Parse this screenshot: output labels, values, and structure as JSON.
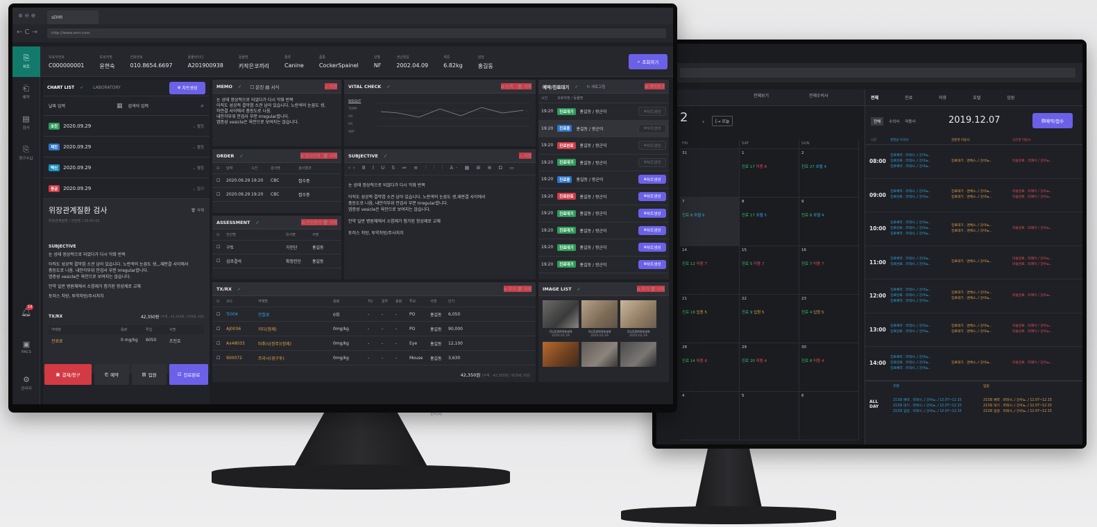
{
  "browser": {
    "tab": "sEMR",
    "url": "http://www.emr.com"
  },
  "patient": [
    {
      "label": "보호자번호",
      "value": "C000000001"
    },
    {
      "label": "보호자명",
      "value": "윤현숙"
    },
    {
      "label": "전화번호",
      "value": "010.8654.6697"
    },
    {
      "label": "동물바이디",
      "value": "A201900938"
    },
    {
      "label": "동물명",
      "value": "키작은코끼리"
    },
    {
      "label": "종류",
      "value": "Canine"
    },
    {
      "label": "품종",
      "value": "CockerSpainel"
    },
    {
      "label": "성별",
      "value": "NF"
    },
    {
      "label": "생년월일",
      "value": "2002.04.09"
    },
    {
      "label": "체중",
      "value": "6.82kg"
    },
    {
      "label": "담당",
      "value": "홍길동"
    }
  ],
  "search_button": "조회하기",
  "sidebar": [
    {
      "label": "차트"
    },
    {
      "label": "예약"
    },
    {
      "label": "검사"
    },
    {
      "label": "청구수납"
    },
    {
      "label": "PACS"
    },
    {
      "label": "관리자"
    }
  ],
  "notification_count": "14",
  "chart_list": {
    "tab1": "CHART LIST",
    "tab2": "LABORATORY",
    "new_button": "차트생성",
    "date_placeholder": "날짜 입력",
    "search_placeholder": "검색어 입력",
    "entries": [
      {
        "tag": "초진",
        "date": "2020.09.29",
        "color": "g",
        "action": "펼침"
      },
      {
        "tag": "재진",
        "date": "2020.09.29",
        "color": "b",
        "action": "펼침"
      },
      {
        "tag": "백신",
        "date": "2020.09.29",
        "color": "cy",
        "action": "펼침"
      },
      {
        "tag": "응급",
        "date": "2020.09.29",
        "color": "r",
        "action": "접기"
      }
    ],
    "detail_title": "위장관계질환 검사",
    "detail_sub": "위장관계질환 / 진단명 / 15:41:02",
    "delete": "삭제",
    "subjective_head": "SUBJECTIVE",
    "subjective_lines": [
      "눈 상태 정상적으로 되었다가 다시 악화 반복",
      "아직도 성공적 결막염 소견 남아 있습니다. 노란색의 눈꼽도 생,,,재판결 사이에서",
      "충등도로 나옴. 내안각부위 안검사 부분 Irregular합니다.",
      "엽증성 vesicle은 육안으로 보여지는 않습니다.",
      "안약 일반 병원체에서 소염제가 첨가된 항상제로 교체",
      "토러스 처방, 투약처방/주사처치"
    ],
    "txrx_label": "TX/RX",
    "txrx_total": "42,350원",
    "txrx_total_note": "(수액 , 42,350원 / 비과세, 0원)",
    "txrx_cols": [
      "약재명",
      "용량",
      "투입",
      "서명"
    ],
    "txrx_row": [
      "진료료",
      "0 mg/kg",
      "6050",
      "조진호"
    ],
    "buttons": {
      "pay": "결제/청구",
      "reserve": "예약",
      "admit": "입원",
      "done": "진료완료"
    }
  },
  "memo": {
    "title": "MEMO",
    "opt1": "문진",
    "opt2": "서식",
    "save": "저장",
    "lines": [
      "눈 상태 정상적으로 되었다가 다시 악화 반복",
      "아직도 성공적 결막염 소견 남아 있습니다. 노란색의 눈꼽도 생,",
      "하얀결 사이에서 충등도로 나옴.",
      "내안각부위 안검사 부분 Irregular합니다.",
      "엽증성 vesicle은 육안으로 보여지는 않습니다."
    ]
  },
  "vital": {
    "title": "VITAL CHECK",
    "add": "등록",
    "del": "삭제",
    "rows": [
      "WEIGHT",
      "TEMP",
      "HR",
      "RR",
      "SBP"
    ]
  },
  "order": {
    "title": "ORDER",
    "apply": "검사신청",
    "del": "삭제",
    "cols": [
      "날짜",
      "시간",
      "검사명",
      "검사결과"
    ],
    "rows": [
      [
        "2020.09.29",
        "19:20",
        "CBC",
        "접수중"
      ],
      [
        "2020.09.29",
        "19:20",
        "CBC",
        "접수중"
      ]
    ]
  },
  "assessment": {
    "title": "ASSESSMENT",
    "add": "진단추가",
    "del": "삭제",
    "cols": [
      "진단명",
      "유사명",
      "서명"
    ],
    "rows": [
      [
        "구토",
        "가진단",
        "홍길동"
      ],
      [
        "심로결석",
        "확정진단",
        "홍길동"
      ]
    ]
  },
  "subjective": {
    "title": "SUBJECTIVE",
    "save": "저장",
    "lines": [
      "눈 상태 정상적으로 되었다가 다시 악화 반복",
      "아직도 성공적 결막염 소견 남아 있습니다. 노란색의 눈꼽도 생,재판결 사이에서",
      "충등도로 나옴, 내안각부위 안검사 부분 Irregular합니다.",
      "엽증성 vesicle은 육안으로 보여지는 않습니다.",
      "안약 일반 병원체에서 소염제가 첨가된 항상제로 교체",
      "토러스 처방, 투약처방/주사처치"
    ]
  },
  "txrx": {
    "title": "TX/RX",
    "add": "추가",
    "del": "삭제",
    "cols": [
      "코드",
      "약재명",
      "용량",
      "TQ",
      "일투",
      "총량",
      "투모",
      "서명",
      "단가"
    ],
    "rows": [
      [
        "Tr004",
        "진찰료",
        "0회",
        "-",
        "-",
        "-",
        "PO",
        "홍길동",
        "6,050"
      ],
      [
        "AJ0036",
        "카디(정제)",
        "0mg/kg",
        "-",
        "-",
        "-",
        "PO",
        "홍길동",
        "90,000"
      ],
      [
        "Ax48033",
        "마취시(정주)(정제)",
        "0mg/kg",
        "-",
        "-",
        "-",
        "Eye",
        "홍길동",
        "12,100"
      ],
      [
        "900072",
        "프라시(경구투)",
        "0mg/kg",
        "-",
        "-",
        "-",
        "Mouse",
        "홍길동",
        "3,630"
      ]
    ],
    "total": "42,350원",
    "note": "(수액 , 42,350원 / 비과세, 0원)"
  },
  "waiting": {
    "title": "예약/진료대기",
    "refresh": "새로고침",
    "add": "예약추가",
    "cols": [
      "시간",
      "보호자명 / 동물명"
    ],
    "rows": [
      {
        "time": "19:20",
        "tag": "진료대기",
        "color": "g",
        "name": "홍길동 / 왕군이",
        "btn": "차트생성",
        "active": false
      },
      {
        "time": "19:20",
        "tag": "진료중",
        "color": "b",
        "name": "홍길동 / 왕군이",
        "btn": "차트생성",
        "active": false
      },
      {
        "time": "19:20",
        "tag": "진료완료",
        "color": "r",
        "name": "홍길동 / 왕군이",
        "btn": "차트생성",
        "active": false
      },
      {
        "time": "19:20",
        "tag": "진료대기",
        "color": "g",
        "name": "홍길동 / 왕군이",
        "btn": "차트생성",
        "active": false
      },
      {
        "time": "19:20",
        "tag": "진료중",
        "color": "b",
        "name": "홍길동 / 왕군이",
        "btn": "차트생성",
        "active": true
      },
      {
        "time": "19:20",
        "tag": "진료완료",
        "color": "r",
        "name": "홍길동 / 왕군이",
        "btn": "차트생성",
        "active": true
      },
      {
        "time": "19:20",
        "tag": "진료대기",
        "color": "g",
        "name": "홍길동 / 왕군이",
        "btn": "차트생성",
        "active": true
      },
      {
        "time": "19:20",
        "tag": "진료대기",
        "color": "g",
        "name": "홍길동 / 왕군이",
        "btn": "차트생성",
        "active": true
      },
      {
        "time": "19:20",
        "tag": "진료대기",
        "color": "g",
        "name": "홍길동 / 왕군이",
        "btn": "차트생성",
        "active": true
      },
      {
        "time": "19:20",
        "tag": "진료대기",
        "color": "g",
        "name": "홍길동 / 왕군이",
        "btn": "차트생성",
        "active": true
      }
    ]
  },
  "images": {
    "title": "IMAGE LIST",
    "add": "추가",
    "del": "삭제",
    "captions": [
      [
        "기니디아어야사아",
        "2020.02.29"
      ],
      [
        "기니디아어야사아",
        "2020.02.29"
      ],
      [
        "기니디아어야사아",
        "2020.02.29"
      ]
    ]
  },
  "back": {
    "filter1": "전체보기",
    "filter2": "전체수의사",
    "week_num": "2",
    "today": "오늘",
    "days": [
      "FRI",
      "SAT",
      "SUN"
    ],
    "right_tabs": [
      "전체",
      "진료",
      "미용",
      "호텔",
      "입원"
    ],
    "sub_tabs": [
      "전체",
      "수의사",
      "미용사"
    ],
    "date": "2019.12.07",
    "reserve_btn": "예약/접수",
    "cols": [
      "시간",
      "정영균 수의사",
      "김준영 미용사",
      "고은영 미용사"
    ],
    "times": [
      "08:00",
      "09:00",
      "10:00",
      "11:00",
      "12:00",
      "13:00",
      "14:00"
    ],
    "sample_lines": [
      "진료완료 . 라데시../ 강아뇨..",
      "진료예약 . 라데시../ 강아뇨..",
      "진료대기 . 엔체스../ 강아뇨..",
      "미용완료 . 티페이 / 강아뇨.."
    ],
    "allday": "ALL DAY",
    "allday_lines": [
      "213호 예약 . 라데시../ 강아뇨../ 12.07~12.15",
      "213호 대기 . 라데시../ 강아뇨../ 12.07~12.15",
      "213호 입원 . 라데시../ 강아뇨../ 12.07~12.15"
    ],
    "allday_cols": [
      "호텔",
      "입원"
    ],
    "footer": "관리자"
  }
}
